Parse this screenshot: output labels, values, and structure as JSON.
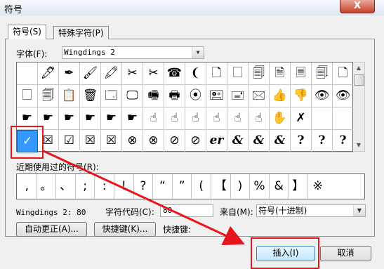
{
  "window": {
    "title": "符号",
    "close_glyph": "X"
  },
  "tabs": [
    {
      "label": "符号(S)"
    },
    {
      "label": "特殊字符(P)"
    }
  ],
  "font": {
    "label": "字体(F):",
    "value": "Wingdings 2"
  },
  "symbols": {
    "rows": [
      [
        "",
        "🖊",
        "✒",
        "🖌",
        "🖍",
        "✂",
        "✂",
        "☎",
        "❨",
        "🗋",
        "🗌",
        "🗐",
        "🗎",
        "🗏",
        "🗐",
        "🗋"
      ],
      [
        "🗌",
        "🗐",
        "📋",
        "🗑",
        "🗔",
        "🖵",
        "🖷",
        "🖶",
        "⦿",
        "🖭",
        "🖃",
        "🖂",
        "👍",
        "👎",
        "👁",
        "👁"
      ],
      [
        "☛",
        "☛",
        "☛",
        "☛",
        "☛",
        "☛",
        "☝",
        "☝",
        "☝",
        "☝",
        "☝",
        "☝",
        "✋",
        "✗",
        "",
        ""
      ],
      [
        "✓",
        "☒",
        "☑",
        "☒",
        "☒",
        "⊗",
        "⊗",
        "⊘",
        "⊘",
        "er",
        "&",
        "&",
        "&",
        "?",
        "?",
        "?"
      ]
    ]
  },
  "recent": {
    "label": "近期使用过的符号(R):",
    "items": [
      ",",
      "。",
      "、",
      ";",
      ":",
      "!",
      "?",
      "“",
      "”",
      "(",
      "【",
      ")",
      "%",
      "&",
      "】",
      "※"
    ]
  },
  "info": {
    "font_code": "Wingdings 2: 80",
    "char_code_label": "字符代码(C):",
    "char_code_value": "80",
    "from_label": "来自(M):",
    "from_value": "符号(十进制)"
  },
  "buttons": {
    "autocorrect": "自动更正(A)...",
    "shortcut_key": "快捷键(K)...",
    "shortcut_label": "快捷键:",
    "insert": "插入(I)",
    "cancel": "取消"
  },
  "colors": {
    "annotation": "#e8141b",
    "selection": "#3399ff"
  }
}
